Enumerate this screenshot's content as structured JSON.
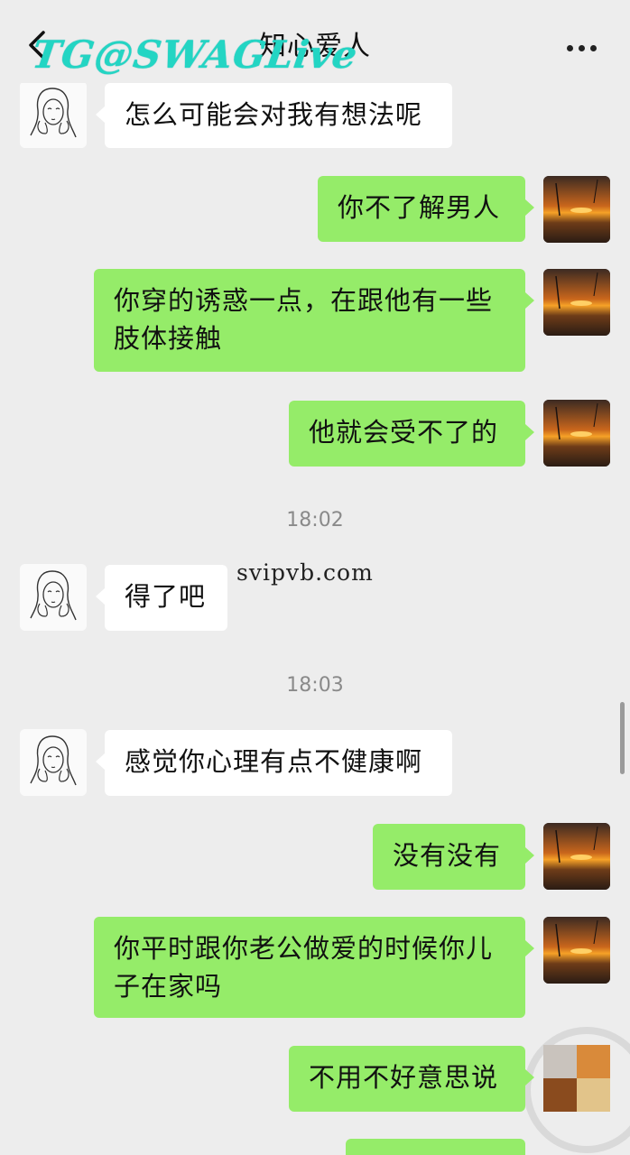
{
  "header": {
    "title": "知心爱人"
  },
  "watermarks": {
    "top_left": "TG@SWAGLive",
    "middle": "svipvb.com"
  },
  "timestamps": [
    "18:02",
    "18:03"
  ],
  "messages": [
    {
      "side": "in",
      "text": "怎么可能会对我有想法呢"
    },
    {
      "side": "out",
      "text": "你不了解男人"
    },
    {
      "side": "out",
      "text": "你穿的诱惑一点，在跟他有一些肢体接触"
    },
    {
      "side": "out",
      "text": "他就会受不了的"
    },
    {
      "side": "in",
      "text": "得了吧"
    },
    {
      "side": "in",
      "text": "感觉你心理有点不健康啊"
    },
    {
      "side": "out",
      "text": "没有没有"
    },
    {
      "side": "out",
      "text": "你平时跟你老公做爱的时候你儿子在家吗"
    },
    {
      "side": "out",
      "text": "不用不好意思说"
    }
  ],
  "colors": {
    "background": "#ededed",
    "incoming_bubble": "#ffffff",
    "outgoing_bubble": "#95ec69",
    "watermark": "#23d5c3"
  },
  "icons": {
    "back": "chevron-left-icon",
    "more": "more-dots-icon",
    "friend_avatar": "sketch-portrait-avatar",
    "my_avatar": "sunset-avatar"
  }
}
